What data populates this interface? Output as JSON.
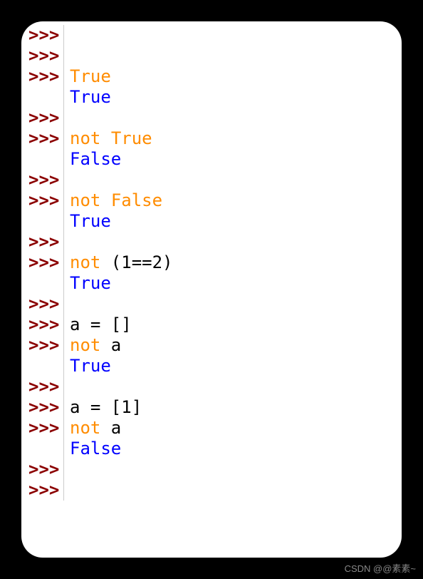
{
  "prompt": ">>>",
  "lines": [
    {
      "gutter": ">>>",
      "tokens": []
    },
    {
      "gutter": ">>>",
      "tokens": []
    },
    {
      "gutter": ">>>",
      "tokens": [
        {
          "t": "True",
          "c": "c-orange"
        }
      ]
    },
    {
      "gutter": "",
      "tokens": [
        {
          "t": "True",
          "c": "c-blue"
        }
      ]
    },
    {
      "gutter": ">>>",
      "tokens": []
    },
    {
      "gutter": ">>>",
      "tokens": [
        {
          "t": "not",
          "c": "c-orange"
        },
        {
          "t": " ",
          "c": "c-black"
        },
        {
          "t": "True",
          "c": "c-orange"
        }
      ]
    },
    {
      "gutter": "",
      "tokens": [
        {
          "t": "False",
          "c": "c-blue"
        }
      ]
    },
    {
      "gutter": ">>>",
      "tokens": []
    },
    {
      "gutter": ">>>",
      "tokens": [
        {
          "t": "not",
          "c": "c-orange"
        },
        {
          "t": " ",
          "c": "c-black"
        },
        {
          "t": "False",
          "c": "c-orange"
        }
      ]
    },
    {
      "gutter": "",
      "tokens": [
        {
          "t": "True",
          "c": "c-blue"
        }
      ]
    },
    {
      "gutter": ">>>",
      "tokens": []
    },
    {
      "gutter": ">>>",
      "tokens": [
        {
          "t": "not",
          "c": "c-orange"
        },
        {
          "t": " (1==2)",
          "c": "c-black"
        }
      ]
    },
    {
      "gutter": "",
      "tokens": [
        {
          "t": "True",
          "c": "c-blue"
        }
      ]
    },
    {
      "gutter": ">>>",
      "tokens": []
    },
    {
      "gutter": ">>>",
      "tokens": [
        {
          "t": "a = []",
          "c": "c-black"
        }
      ]
    },
    {
      "gutter": ">>>",
      "tokens": [
        {
          "t": "not",
          "c": "c-orange"
        },
        {
          "t": " a",
          "c": "c-black"
        }
      ]
    },
    {
      "gutter": "",
      "tokens": [
        {
          "t": "True",
          "c": "c-blue"
        }
      ]
    },
    {
      "gutter": ">>>",
      "tokens": []
    },
    {
      "gutter": ">>>",
      "tokens": [
        {
          "t": "a = [1]",
          "c": "c-black"
        }
      ]
    },
    {
      "gutter": ">>>",
      "tokens": [
        {
          "t": "not",
          "c": "c-orange"
        },
        {
          "t": " a",
          "c": "c-black"
        }
      ]
    },
    {
      "gutter": "",
      "tokens": [
        {
          "t": "False",
          "c": "c-blue"
        }
      ]
    },
    {
      "gutter": ">>>",
      "tokens": []
    },
    {
      "gutter": ">>>",
      "tokens": []
    }
  ],
  "watermark": "CSDN @@素素~"
}
